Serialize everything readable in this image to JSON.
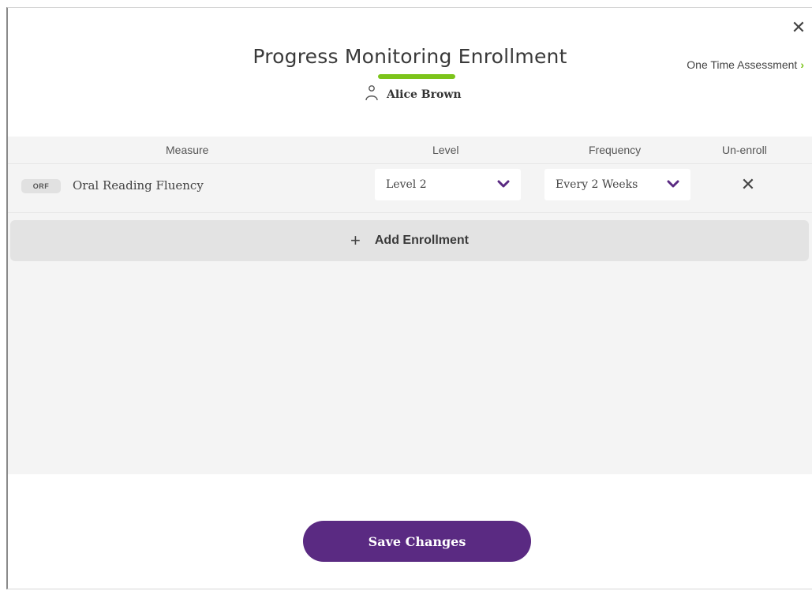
{
  "modal": {
    "title": "Progress Monitoring Enrollment",
    "close_symbol": "✕",
    "student_name": "Alice Brown",
    "one_time_assessment_label": "One Time Assessment",
    "accent_color": "#7cc41b",
    "primary_color": "#5a2a82"
  },
  "table": {
    "headers": {
      "measure": "Measure",
      "level": "Level",
      "frequency": "Frequency",
      "unenroll": "Un-enroll"
    },
    "rows": [
      {
        "tag": "ORF",
        "measure": "Oral Reading Fluency",
        "level": "Level 2",
        "frequency": "Every 2 Weeks",
        "unenroll_symbol": "✕"
      }
    ]
  },
  "add_enrollment": {
    "plus": "+",
    "label": "Add Enrollment"
  },
  "footer": {
    "save_label": "Save Changes"
  }
}
